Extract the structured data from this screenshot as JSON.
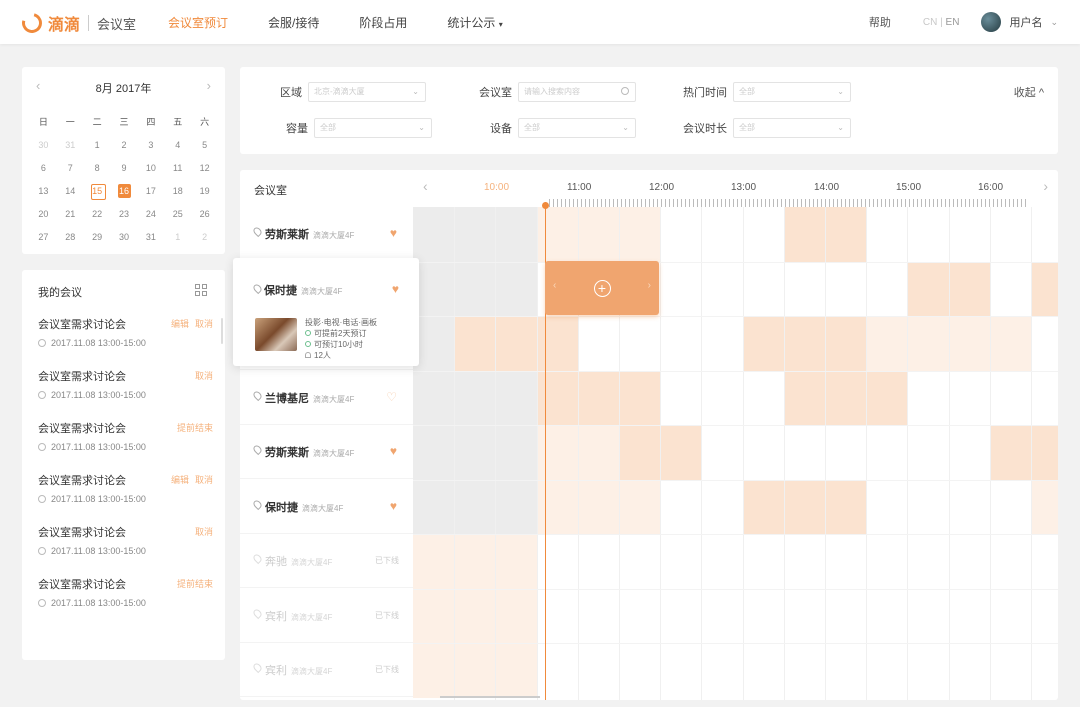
{
  "header": {
    "logo_text": "滴滴",
    "app_name": "会议室",
    "nav": [
      "会议室预订",
      "会服/接待",
      "阶段占用",
      "统计公示"
    ],
    "help": "帮助",
    "lang_cn": "CN",
    "lang_sep": "|",
    "lang_en": "EN",
    "username": "用户名"
  },
  "calendar": {
    "title": "8月 2017年",
    "weekdays": [
      "日",
      "一",
      "二",
      "三",
      "四",
      "五",
      "六"
    ],
    "days": [
      "30",
      "31",
      "1",
      "2",
      "3",
      "4",
      "5",
      "6",
      "7",
      "8",
      "9",
      "10",
      "11",
      "12",
      "13",
      "14",
      "15",
      "16",
      "17",
      "18",
      "19",
      "20",
      "21",
      "22",
      "23",
      "24",
      "25",
      "26",
      "27",
      "28",
      "29",
      "30",
      "31",
      "1",
      "2"
    ],
    "today": "15",
    "selected": "16"
  },
  "my_meetings": {
    "title": "我的会议",
    "items": [
      {
        "title": "会议室需求讨论会",
        "time": "2017.11.08 13:00-15:00",
        "actions": [
          "编辑",
          "取消"
        ]
      },
      {
        "title": "会议室需求讨论会",
        "time": "2017.11.08 13:00-15:00",
        "actions": [
          "取消"
        ]
      },
      {
        "title": "会议室需求讨论会",
        "time": "2017.11.08 13:00-15:00",
        "actions": [
          "提前结束"
        ]
      },
      {
        "title": "会议室需求讨论会",
        "time": "2017.11.08 13:00-15:00",
        "actions": [
          "编辑",
          "取消"
        ]
      },
      {
        "title": "会议室需求讨论会",
        "time": "2017.11.08 13:00-15:00",
        "actions": [
          "取消"
        ]
      },
      {
        "title": "会议室需求讨论会",
        "time": "2017.11.08 13:00-15:00",
        "actions": [
          "提前结束"
        ]
      }
    ]
  },
  "filters": {
    "area_label": "区域",
    "area_value": "北京-滴滴大厦",
    "room_label": "会议室",
    "room_placeholder": "请输入搜索内容",
    "hot_label": "热门时间",
    "hot_value": "全部",
    "capacity_label": "容量",
    "capacity_value": "全部",
    "device_label": "设备",
    "device_value": "全部",
    "duration_label": "会议时长",
    "duration_value": "全部",
    "collapse": "收起 ^"
  },
  "schedule": {
    "room_header": "会议室",
    "hours": [
      "10:00",
      "11:00",
      "12:00",
      "13:00",
      "14:00",
      "15:00",
      "16:00"
    ],
    "rooms": [
      {
        "name": "劳斯莱斯",
        "loc": "滴滴大厦4F",
        "fav": true
      },
      {
        "name": "保时捷",
        "loc": "滴滴大厦4F",
        "fav": true
      },
      {
        "name": "",
        "loc": "",
        "fav": false
      },
      {
        "name": "兰博基尼",
        "loc": "滴滴大厦4F",
        "fav": false
      },
      {
        "name": "劳斯莱斯",
        "loc": "滴滴大厦4F",
        "fav": true
      },
      {
        "name": "保时捷",
        "loc": "滴滴大厦4F",
        "fav": true
      },
      {
        "name": "奔驰",
        "loc": "滴滴大厦4F",
        "status": "已下线"
      },
      {
        "name": "宾利",
        "loc": "滴滴大厦4F",
        "status": "已下线"
      },
      {
        "name": "宾利",
        "loc": "滴滴大厦4F",
        "status": "已下线"
      }
    ],
    "popup": {
      "name": "保时捷",
      "loc": "滴滴大厦4F",
      "equipment": "投影·电视·电话·画板",
      "rule1": "可提前2天预订",
      "rule2": "可预订10小时",
      "capacity": "12人"
    }
  },
  "colors": {
    "accent": "#f08a3c",
    "booked": "#fbe3d0",
    "light": "#fdf0e6",
    "past": "#ececec"
  }
}
